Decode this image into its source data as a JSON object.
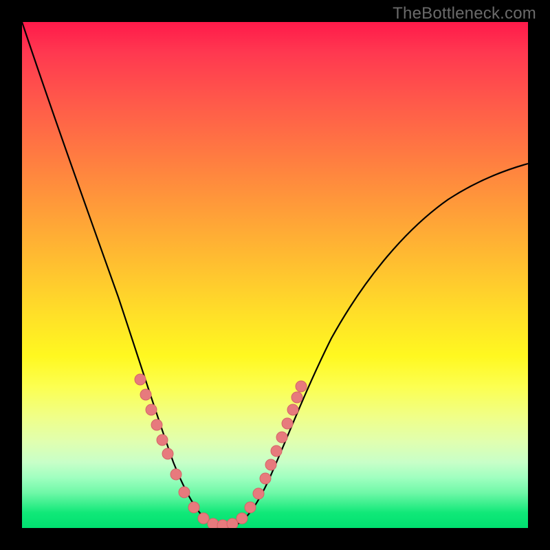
{
  "watermark": {
    "text": "TheBottleneck.com"
  },
  "chart_data": {
    "type": "line",
    "title": "",
    "xlabel": "",
    "ylabel": "",
    "xlim": [
      0,
      100
    ],
    "ylim": [
      0,
      100
    ],
    "grid": false,
    "series": [
      {
        "name": "bottleneck-curve",
        "x": [
          0,
          5,
          10,
          15,
          20,
          24,
          27,
          30,
          33,
          36,
          38,
          40,
          43,
          46,
          50,
          55,
          60,
          70,
          80,
          90,
          100
        ],
        "y": [
          100,
          84,
          68,
          52,
          36,
          23,
          15,
          9,
          4,
          1,
          0,
          0,
          1,
          4,
          10,
          20,
          29,
          44,
          55,
          62,
          67
        ]
      },
      {
        "name": "markers",
        "x": [
          23,
          24,
          25,
          26,
          27,
          28,
          30,
          33,
          36,
          38,
          39,
          40,
          42,
          44,
          45,
          46,
          47,
          48
        ],
        "y": [
          26,
          23,
          20,
          17,
          15,
          12,
          9,
          4,
          1,
          0,
          0,
          0,
          1,
          4,
          7,
          11,
          15,
          19
        ]
      }
    ],
    "colors": {
      "curve": "#000000",
      "marker_fill": "#e77a7d",
      "marker_stroke": "#d46466",
      "gradient_top": "#ff1a4a",
      "gradient_bottom": "#00e070"
    }
  }
}
